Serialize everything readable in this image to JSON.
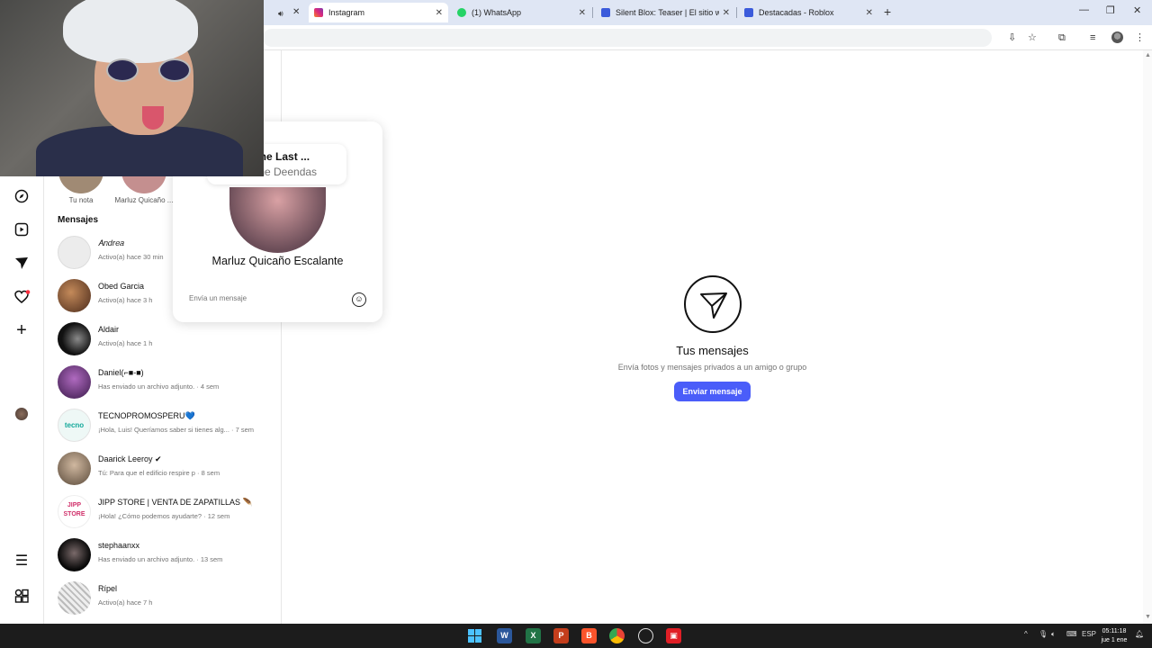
{
  "browser": {
    "tabs": [
      {
        "title": "Instagram",
        "active": true,
        "icon": "instagram-icon"
      },
      {
        "title": "(1) WhatsApp",
        "active": false,
        "icon": "whatsapp-icon"
      },
      {
        "title": "Silent Blox: Teaser | El sitio web",
        "active": false,
        "icon": "roblox-icon"
      },
      {
        "title": "Destacadas - Roblox",
        "active": false,
        "icon": "roblox-icon"
      }
    ],
    "colors": {
      "tabbar": "#dfe6f4",
      "instagram": "#e1306c",
      "whatsapp": "#25d366",
      "roblox": "#3b5bdb"
    }
  },
  "notes": [
    {
      "label": "Tu nota"
    },
    {
      "label": "Marluz Quicaño ..."
    }
  ],
  "messages_heading": "Mensajes",
  "conversations": [
    {
      "name": "𝐴𝑛𝑑𝑟𝑒𝑎",
      "meta": "Activo(a) hace 30 min",
      "color": "#e8e8e8"
    },
    {
      "name": "Obed Garcia",
      "meta": "Activo(a) hace 3 h",
      "color": "#7a4b3a"
    },
    {
      "name": "Aldair",
      "meta": "Activo(a) hace 1 h",
      "color": "#2a2a2a"
    },
    {
      "name": "Daniel(⌐■-■)",
      "meta": "Has enviado un archivo adjunto. · 4 sem",
      "color": "#5a2d6b"
    },
    {
      "name": "TECNOPROMOSPERU💙",
      "meta": "¡Hola, Luis! Queríamos saber si tienes alg... · 7 sem",
      "color": "#e9f7f4"
    },
    {
      "name": "Daarick Leeroy ✔",
      "meta": "Tú: Para que el edificio respire p · 8 sem",
      "color": "#8a7a6a"
    },
    {
      "name": "JIPP STORE | VENTA DE ZAPATILLAS 🪶",
      "meta": "¡Hola! ¿Cómo podemos ayudarte? · 12 sem",
      "color": "#ffffff"
    },
    {
      "name": "stephaanxx",
      "meta": "Has enviado un archivo adjunto. · 13 sem",
      "color": "#1a1a1a"
    },
    {
      "name": "Rípel",
      "meta": "Activo(a) hace 7 h",
      "color": "#dcdcdc"
    }
  ],
  "note_card": {
    "song": "re the Last ...",
    "artist": "The Deendas",
    "full_name": "Marluz Quicaño Escalante",
    "reply_placeholder": "Envía un mensaje"
  },
  "empty_state": {
    "title": "Tus mensajes",
    "subtitle": "Envía fotos y mensajes privados a un amigo o grupo",
    "button": "Enviar mensaje",
    "accent": "#4a5df9"
  },
  "taskbar": {
    "lang": "ESP",
    "time": "05:11:18",
    "date": "jue 1 ene"
  }
}
